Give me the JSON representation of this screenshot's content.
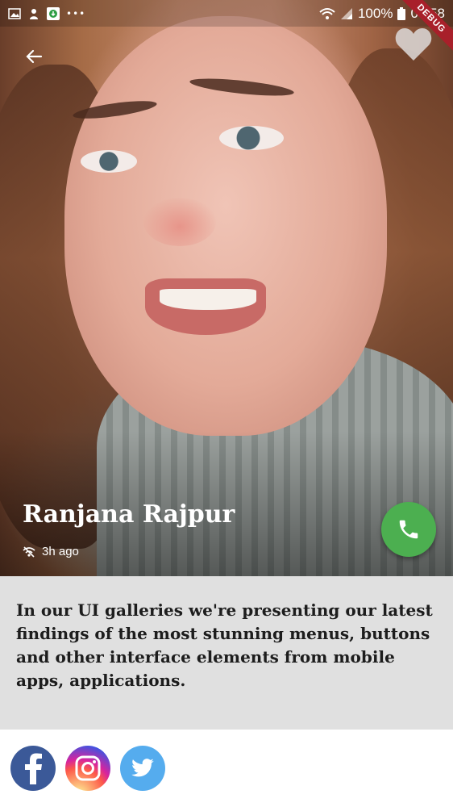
{
  "status_bar": {
    "battery": "100%",
    "time": "06:58",
    "icons": [
      "image-icon",
      "person-icon",
      "download-icon",
      "more-dots-icon",
      "wifi-icon",
      "signal-icon",
      "battery-icon"
    ]
  },
  "debug_banner": "DEBUG",
  "profile": {
    "name": "Ranjana Rajpur",
    "time_ago": "3h ago"
  },
  "description": "In our UI galleries we're presenting our latest findings of the most stunning menus, buttons and other interface elements from mobile apps, applications.",
  "social": [
    "facebook",
    "instagram",
    "twitter"
  ],
  "colors": {
    "call_button": "#4caf50",
    "description_bg": "#e0e0e0",
    "facebook": "#3b5998",
    "twitter": "#55acee",
    "debug_ribbon": "#a8202a"
  }
}
